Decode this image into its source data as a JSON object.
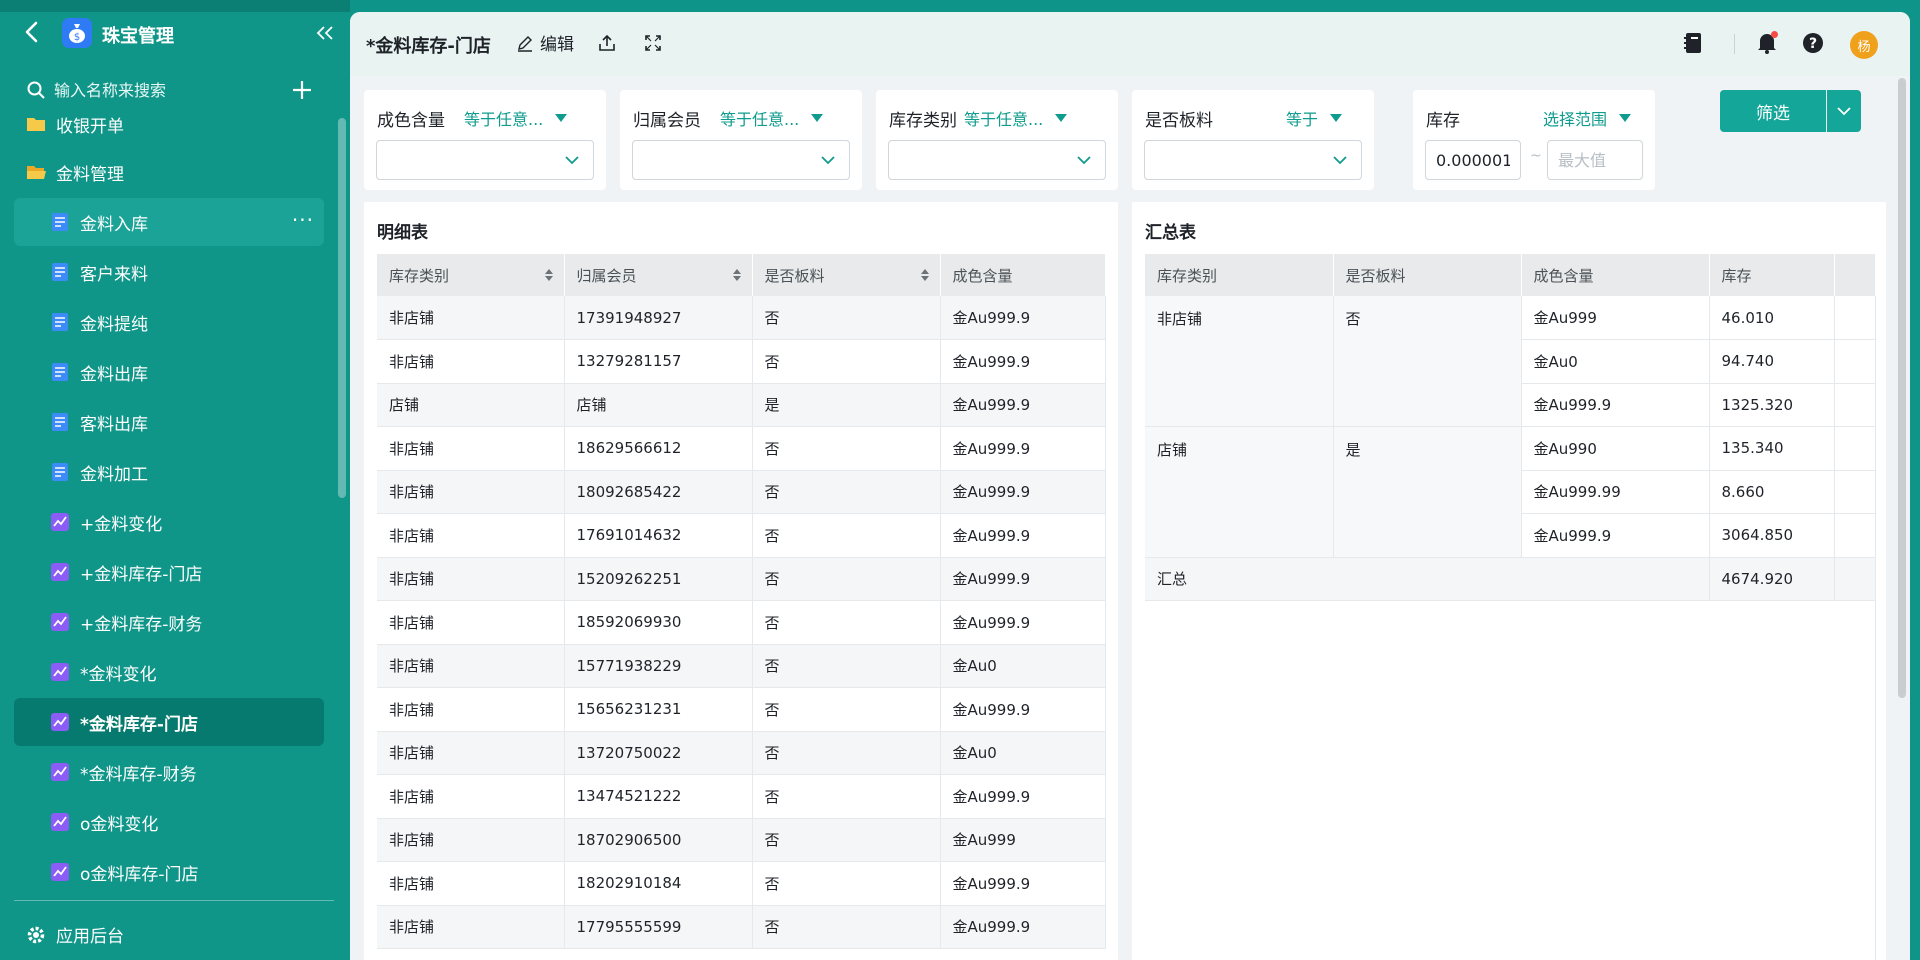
{
  "app": {
    "name": "珠宝管理"
  },
  "sidebar": {
    "search_placeholder": "输入名称来搜索",
    "items": [
      {
        "label": "收银开单"
      },
      {
        "label": "金料管理"
      },
      {
        "label": "金料入库"
      },
      {
        "label": "客户来料"
      },
      {
        "label": "金料提纯"
      },
      {
        "label": "金料出库"
      },
      {
        "label": "客料出库"
      },
      {
        "label": "金料加工"
      },
      {
        "label": "+金料变化"
      },
      {
        "label": "+金料库存-门店"
      },
      {
        "label": "+金料库存-财务"
      },
      {
        "label": "*金料变化"
      },
      {
        "label": "*金料库存-门店"
      },
      {
        "label": "*金料库存-财务"
      },
      {
        "label": "o金料变化"
      },
      {
        "label": "o金料库存-门店"
      }
    ],
    "more_dots": "···",
    "footer_label": "应用后台"
  },
  "topbar": {
    "title": "*金料库存-门店",
    "edit_label": "编辑",
    "avatar_text": "杨"
  },
  "filters": [
    {
      "label": "成色含量",
      "op": "等于任意..."
    },
    {
      "label": "归属会员",
      "op": "等于任意..."
    },
    {
      "label": "库存类别",
      "op": "等于任意..."
    },
    {
      "label": "是否板料",
      "op": "等于"
    },
    {
      "label": "库存",
      "op": "选择范围",
      "min_value": "0.000001",
      "max_placeholder": "最大值",
      "tilde": "~"
    }
  ],
  "filter_button": "筛选",
  "detail": {
    "title": "明细表",
    "columns": [
      "库存类别",
      "归属会员",
      "是否板料",
      "成色含量"
    ],
    "rows": [
      [
        "非店铺",
        "17391948927",
        "否",
        "金Au999.9"
      ],
      [
        "非店铺",
        "13279281157",
        "否",
        "金Au999.9"
      ],
      [
        "店铺",
        "店铺",
        "是",
        "金Au999.9"
      ],
      [
        "非店铺",
        "18629566612",
        "否",
        "金Au999.9"
      ],
      [
        "非店铺",
        "18092685422",
        "否",
        "金Au999.9"
      ],
      [
        "非店铺",
        "17691014632",
        "否",
        "金Au999.9"
      ],
      [
        "非店铺",
        "15209262251",
        "否",
        "金Au999.9"
      ],
      [
        "非店铺",
        "18592069930",
        "否",
        "金Au999.9"
      ],
      [
        "非店铺",
        "15771938229",
        "否",
        "金Au0"
      ],
      [
        "非店铺",
        "15656231231",
        "否",
        "金Au999.9"
      ],
      [
        "非店铺",
        "13720750022",
        "否",
        "金Au0"
      ],
      [
        "非店铺",
        "13474521222",
        "否",
        "金Au999.9"
      ],
      [
        "非店铺",
        "18702906500",
        "否",
        "金Au999"
      ],
      [
        "非店铺",
        "18202910184",
        "否",
        "金Au999.9"
      ],
      [
        "非店铺",
        "17795555599",
        "否",
        "金Au999.9"
      ]
    ]
  },
  "summary": {
    "title": "汇总表",
    "columns": [
      "库存类别",
      "是否板料",
      "成色含量",
      "库存"
    ],
    "groups": [
      {
        "category": "非店铺",
        "plate": "否",
        "rows": [
          [
            "金Au999",
            "46.010"
          ],
          [
            "金Au0",
            "94.740"
          ],
          [
            "金Au999.9",
            "1325.320"
          ]
        ]
      },
      {
        "category": "店铺",
        "plate": "是",
        "rows": [
          [
            "金Au990",
            "135.340"
          ],
          [
            "金Au999.99",
            "8.660"
          ],
          [
            "金Au999.9",
            "3064.850"
          ]
        ]
      }
    ],
    "total_label": "汇总",
    "total_value": "4674.920"
  },
  "colors": {
    "sidebar_bg": "#0f9689",
    "accent": "#14a698",
    "active_item": "#077a6f"
  }
}
